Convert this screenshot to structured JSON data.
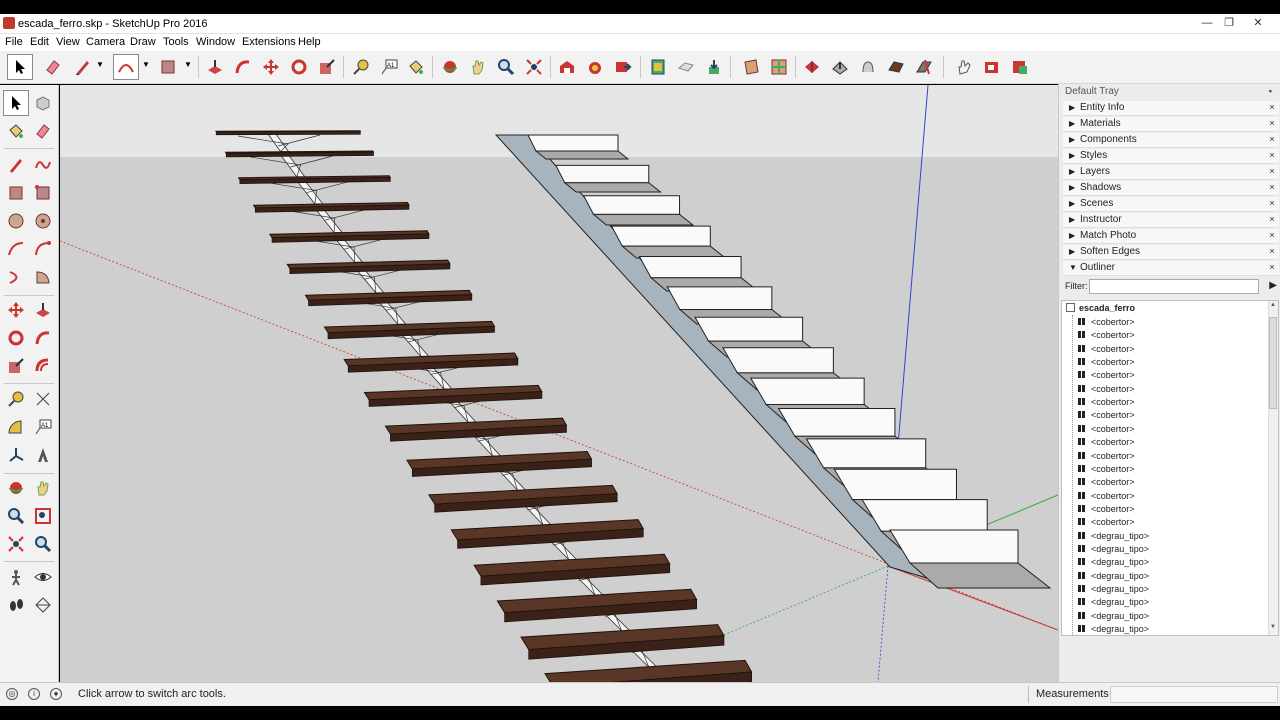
{
  "window": {
    "title": "escada_ferro.skp - SketchUp Pro 2016",
    "controls": [
      "minimize-icon",
      "restore-icon",
      "close-icon"
    ]
  },
  "menu": [
    "File",
    "Edit",
    "View",
    "Camera",
    "Draw",
    "Tools",
    "Window",
    "Extensions",
    "Help"
  ],
  "toolbar": {
    "tools": [
      "select-icon",
      "eraser-icon",
      "pencil-icon",
      "arc-icon",
      "rectangle-icon",
      "push-pull-icon",
      "follow-me-icon",
      "move-icon",
      "rotate-icon",
      "scale-icon",
      "tape-measure-icon",
      "text-icon",
      "paint-bucket-icon",
      "orbit-icon",
      "pan-icon",
      "zoom-icon",
      "zoom-extents-icon",
      "warehouse-icon",
      "extension-warehouse-icon",
      "send-to-layout-icon",
      "sandbox-icon",
      "outer-shell-icon",
      "solid-union-icon",
      "warehouse-upload-icon",
      "section-plane-icon",
      "terrain-icon",
      "contours-icon",
      "smoove-icon",
      "stamp-icon",
      "drape-icon",
      "add-detail-icon",
      "flip-edge-icon",
      "pointer-icon",
      "export-icon",
      "plugin-icon"
    ]
  },
  "tray": {
    "title": "Default Tray",
    "pin": "📌",
    "panels": [
      {
        "label": "Entity Info",
        "expanded": false
      },
      {
        "label": "Materials",
        "expanded": false
      },
      {
        "label": "Components",
        "expanded": false
      },
      {
        "label": "Styles",
        "expanded": false
      },
      {
        "label": "Layers",
        "expanded": false
      },
      {
        "label": "Shadows",
        "expanded": false
      },
      {
        "label": "Scenes",
        "expanded": false
      },
      {
        "label": "Instructor",
        "expanded": false
      },
      {
        "label": "Match Photo",
        "expanded": false
      },
      {
        "label": "Soften Edges",
        "expanded": false
      },
      {
        "label": "Outliner",
        "expanded": true
      }
    ],
    "close_glyph": "×",
    "filter_label": "Filter:",
    "filter_value": "",
    "outliner_root": "escada_ferro",
    "outliner_items": [
      "<cobertor>",
      "<cobertor>",
      "<cobertor>",
      "<cobertor>",
      "<cobertor>",
      "<cobertor>",
      "<cobertor>",
      "<cobertor>",
      "<cobertor>",
      "<cobertor>",
      "<cobertor>",
      "<cobertor>",
      "<cobertor>",
      "<cobertor>",
      "<cobertor>",
      "<cobertor>",
      "<degrau_tipo>",
      "<degrau_tipo>",
      "<degrau_tipo>",
      "<degrau_tipo>",
      "<degrau_tipo>",
      "<degrau_tipo>",
      "<degrau_tipo>",
      "<degrau_tipo>"
    ]
  },
  "status": {
    "message": "Click arrow to switch arc tools.",
    "measurements_label": "Measurements",
    "measurements_value": ""
  },
  "colors": {
    "tread_wood": "#5a3626",
    "ground": "#cfcfcf",
    "sky": "#e6e6e6",
    "axis_red": "#cc3333",
    "axis_green": "#33aa33",
    "axis_blue": "#3344cc"
  }
}
